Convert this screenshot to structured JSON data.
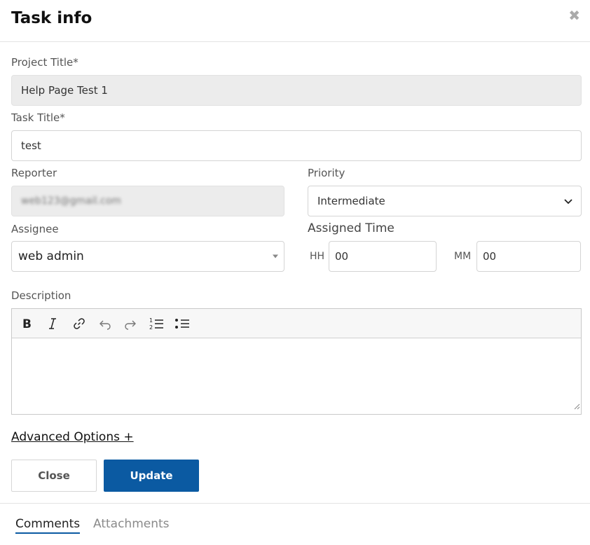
{
  "modal": {
    "title": "Task info",
    "close_icon": "close-icon"
  },
  "form": {
    "project_title": {
      "label": "Project Title*",
      "value": "Help Page Test 1"
    },
    "task_title": {
      "label": "Task Title*",
      "value": "test"
    },
    "reporter": {
      "label": "Reporter",
      "value": "web123@gmail.com"
    },
    "priority": {
      "label": "Priority",
      "value": "Intermediate"
    },
    "assignee": {
      "label": "Assignee",
      "value": "web admin"
    },
    "assigned_time": {
      "label": "Assigned Time",
      "hh_label": "HH",
      "hh_value": "00",
      "mm_label": "MM",
      "mm_value": "00"
    },
    "description": {
      "label": "Description",
      "toolbar": [
        "bold-icon",
        "italic-icon",
        "link-icon",
        "undo-icon",
        "redo-icon",
        "numbered-list-icon",
        "bulleted-list-icon"
      ],
      "value": ""
    }
  },
  "advanced_options": "Advanced Options +",
  "buttons": {
    "close": "Close",
    "update": "Update"
  },
  "tabs": [
    {
      "label": "Comments",
      "active": true
    },
    {
      "label": "Attachments",
      "active": false
    }
  ],
  "colors": {
    "primary": "#0b5aa2",
    "disabled_bg": "#ececec"
  }
}
